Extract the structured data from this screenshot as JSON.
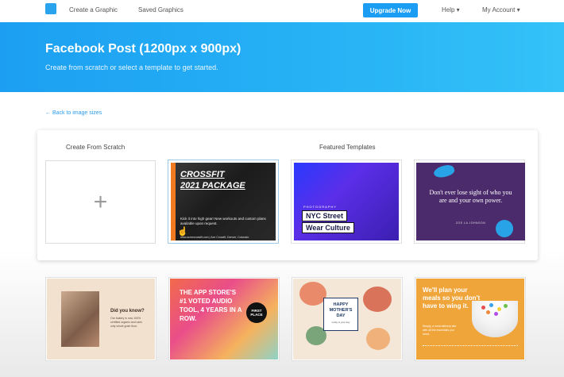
{
  "nav": {
    "links": [
      "Create a Graphic",
      "Saved Graphics"
    ],
    "upgrade_label": "Upgrade Now",
    "help_label": "Help ▾",
    "account_label": "My Account ▾"
  },
  "hero": {
    "title": "Facebook Post (1200px x 900px)",
    "subtitle": "Create from scratch or select a template to get started."
  },
  "back_link": "← Back to image sizes",
  "panel": {
    "scratch_heading": "Create From Scratch",
    "featured_heading": "Featured Templates",
    "plus": "+"
  },
  "templates": {
    "crossfit": {
      "title_line1": "CROSSFIT",
      "title_line2": "2021 PACKAGE",
      "desc": "Kick it into high gear! New workouts and custom plans available upon request.",
      "footer": "www.acmecrossfit.com  |  Ace Crossfit, Denver, Colorado"
    },
    "nyc": {
      "small": "PHOTOGRAPHY",
      "line1": "NYC Street",
      "line2": "Wear Culture"
    },
    "quote": {
      "text": "Don't ever lose sight of who you are and your own power.",
      "author": "ZOE LA JOHNSON"
    },
    "didyouknow": {
      "title": "Did you know?",
      "text": "Our bakery is now 100% certified organic and uses only whole grain flour."
    },
    "appstore": {
      "text": "THE APP STORE'S #1 VOTED AUDIO TOOL, 4 YEARS IN A ROW.",
      "badge": "FIRST PLACE"
    },
    "mothers": {
      "line1": "HAPPY",
      "line2": "MOTHER'S",
      "line3": "DAY",
      "sub": "today is your day"
    },
    "meals": {
      "text": "We'll plan your meals so you don't have to wing it.",
      "sub": "Simply, a meal delivery site with all the essentials you need."
    }
  }
}
